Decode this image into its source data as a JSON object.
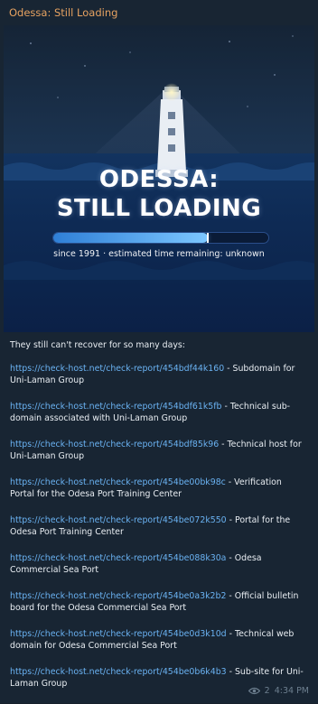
{
  "post": {
    "title": "Odessa: Still Loading",
    "hero": {
      "headline_line1": "ODESSA:",
      "headline_line2": "STILL LOADING",
      "progress": 0.72,
      "caption": "since 1991 · estimated time remaining: unknown"
    },
    "intro": "They still can't recover for so many days:",
    "items": [
      {
        "link": "https://check-host.net/check-report/454bdf44k160",
        "desc": " - Subdomain for Uni-Laman Group"
      },
      {
        "link": "https://check-host.net/check-report/454bdf61k5fb",
        "desc": " - Technical sub-domain associated with Uni-Laman Group"
      },
      {
        "link": "https://check-host.net/check-report/454bdf85k96",
        "desc": " - Technical host for Uni-Laman Group"
      },
      {
        "link": "https://check-host.net/check-report/454be00bk98c",
        "desc": " - Verification Portal for the Odesa Port Training Center"
      },
      {
        "link": "https://check-host.net/check-report/454be072k550",
        "desc": " - Portal for the Odesa Port Training Center"
      },
      {
        "link": "https://check-host.net/check-report/454be088k30a",
        "desc": " - Odesa Commercial Sea Port"
      },
      {
        "link": "https://check-host.net/check-report/454be0a3k2b2",
        "desc": " - Official bulletin board for the Odesa Commercial Sea Port"
      },
      {
        "link": "https://check-host.net/check-report/454be0d3k10d",
        "desc": " - Technical web domain for Odesa Commercial Sea Port"
      },
      {
        "link": "https://check-host.net/check-report/454be0b6k4b3",
        "desc": " - Sub-site for Uni-Laman Group"
      }
    ],
    "meta": {
      "views": "2",
      "time": "4:34 PM",
      "icon": "eye-icon"
    }
  },
  "colors": {
    "title": "#e6a261",
    "link": "#6ab2f2",
    "background": "#182533",
    "meta": "#6d7f8f"
  }
}
